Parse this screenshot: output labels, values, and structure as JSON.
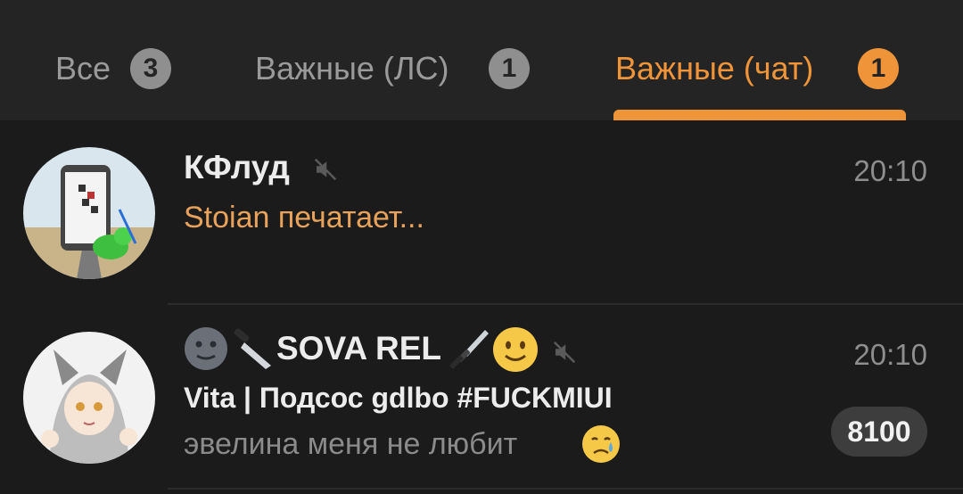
{
  "tabs": [
    {
      "label": "Все",
      "badge": "3"
    },
    {
      "label": "Важные (ЛС)",
      "badge": "1"
    },
    {
      "label": "Важные (чат)",
      "badge": "1",
      "active": true
    }
  ],
  "colors": {
    "accent": "#f0943a",
    "background": "#1b1b1b",
    "tabbar": "#242424",
    "muted_text": "#8b8b8b",
    "typing_text": "#e8a25a"
  },
  "chats": [
    {
      "title": "КФлуд",
      "time": "20:10",
      "muted": true,
      "status": "Stoian печатает..."
    },
    {
      "title": "SOVA REL",
      "title_emoji": [
        "neutral-face-emoji",
        "knife-emoji",
        "dagger-emoji",
        "slightly-smiling-face-emoji"
      ],
      "time": "20:10",
      "muted": true,
      "sender": "Vita | Подсос gdlbo #FUCKMIUI",
      "preview": "эвелина меня не любит",
      "preview_emoji": "crying-face-emoji",
      "unread": "8100"
    }
  ]
}
